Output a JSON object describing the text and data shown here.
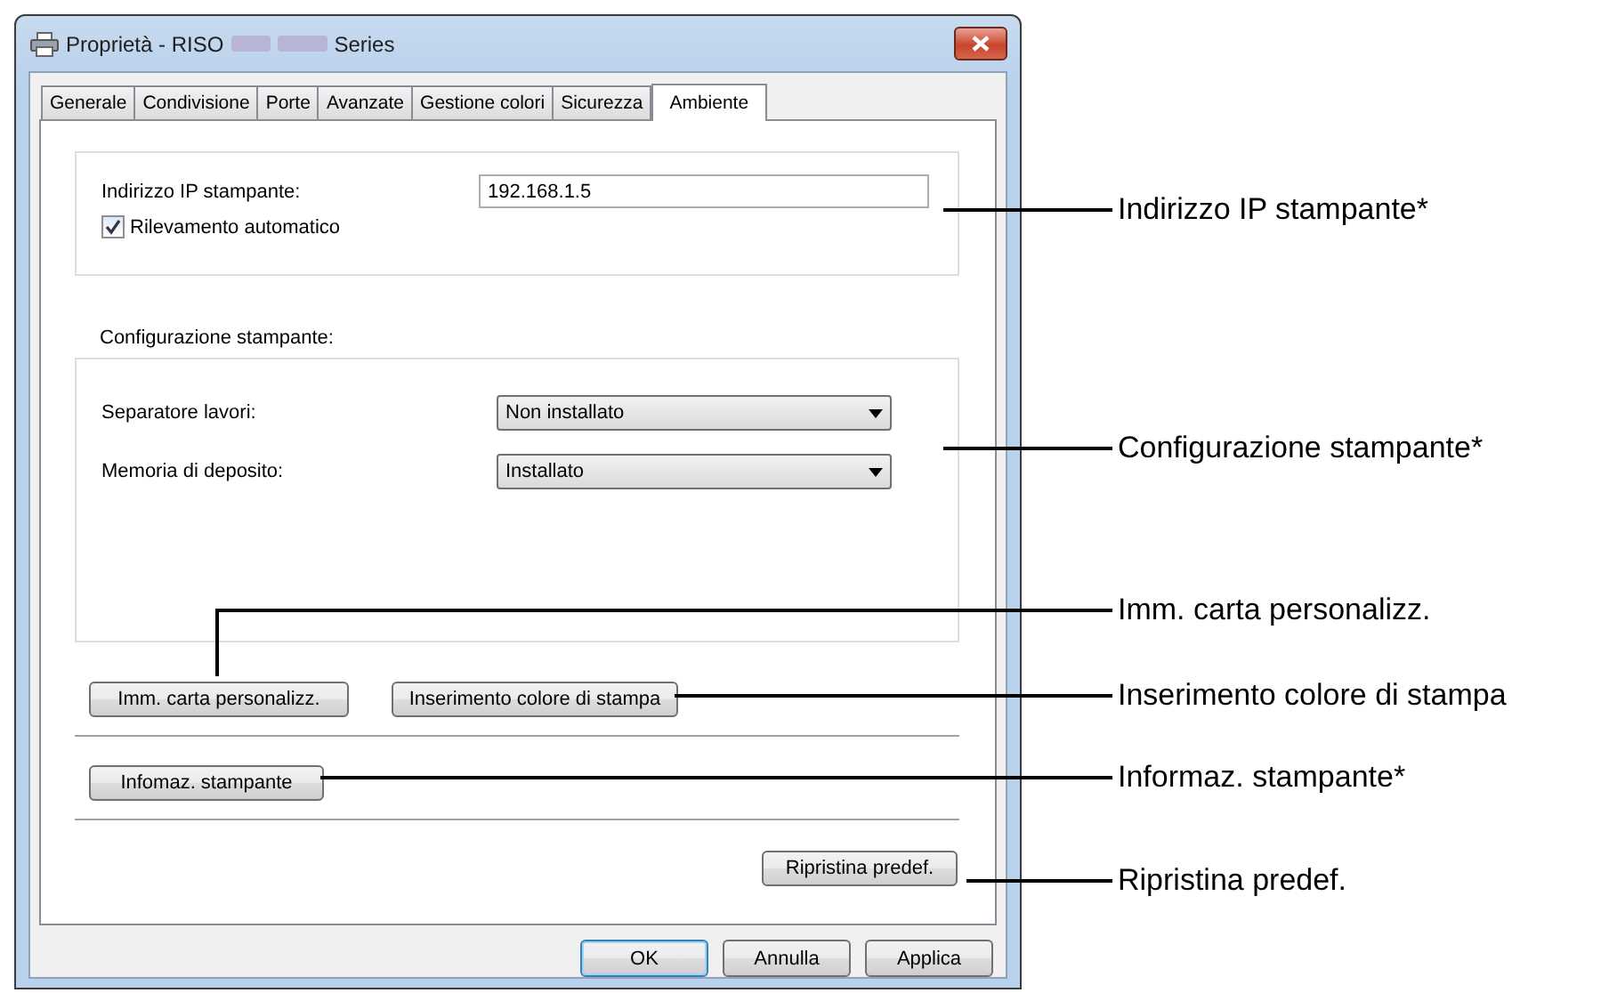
{
  "window": {
    "title_start": "Proprietà - RISO",
    "title_end": "Series"
  },
  "tabs": [
    {
      "label": "Generale",
      "selected": false
    },
    {
      "label": "Condivisione",
      "selected": false
    },
    {
      "label": "Porte",
      "selected": false
    },
    {
      "label": "Avanzate",
      "selected": false
    },
    {
      "label": "Gestione colori",
      "selected": false
    },
    {
      "label": "Sicurezza",
      "selected": false
    },
    {
      "label": "Ambiente",
      "selected": true
    }
  ],
  "ip_group": {
    "label": "Indirizzo IP stampante:",
    "value": "192.168.1.5",
    "auto_detect": {
      "label": "Rilevamento automatico",
      "checked": true
    }
  },
  "config": {
    "heading": "Configurazione stampante:",
    "fields": [
      {
        "label": "Separatore lavori:",
        "value": "Non installato"
      },
      {
        "label": "Memoria di deposito:",
        "value": "Installato"
      }
    ]
  },
  "option_buttons": [
    "Imm. carta personalizz.",
    "Inserimento colore di stampa"
  ],
  "info_button": "Infomaz. stampante",
  "restore_button": "Ripristina predef.",
  "dialog_buttons": [
    {
      "label": "OK",
      "default": true
    },
    {
      "label": "Annulla",
      "default": false
    },
    {
      "label": "Applica",
      "default": false
    }
  ],
  "callouts": [
    {
      "label": "Indirizzo IP stampante*"
    },
    {
      "label": "Configurazione stampante*"
    },
    {
      "label": "Imm. carta personalizz."
    },
    {
      "label": "Inserimento colore di stampa"
    },
    {
      "label": "Informaz. stampante*"
    },
    {
      "label": "Ripristina predef."
    }
  ]
}
